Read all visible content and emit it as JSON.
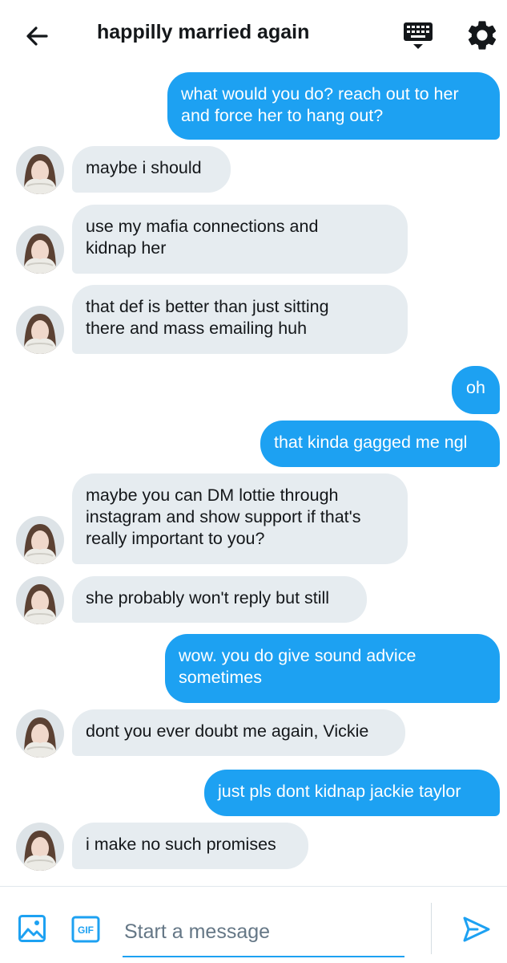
{
  "header": {
    "title": "happilly married again",
    "back_icon": "arrow-left-icon",
    "keyboard_icon": "keyboard-icon",
    "settings_icon": "gear-icon"
  },
  "colors": {
    "accent": "#1da1f2",
    "incoming_bubble": "#e6ecf0",
    "text": "#14171a",
    "placeholder": "#657786"
  },
  "messages": [
    {
      "from": "me",
      "text": "what would you do? reach out to her\nand force her to hang out?"
    },
    {
      "from": "them",
      "text": "maybe i should"
    },
    {
      "from": "them",
      "text": "use my mafia connections and\nkidnap her"
    },
    {
      "from": "them",
      "text": "that def is better than just sitting\nthere and mass emailing huh"
    },
    {
      "from": "me",
      "text": "oh"
    },
    {
      "from": "me",
      "text": "that kinda gagged me ngl"
    },
    {
      "from": "them",
      "text": "maybe you can DM lottie through\ninstagram and show support if that's\nreally important to you?"
    },
    {
      "from": "them",
      "text": "she probably won't reply but still"
    },
    {
      "from": "me",
      "text": "wow. you do give sound advice\nsometimes"
    },
    {
      "from": "them",
      "text": "dont you ever doubt me again, Vickie"
    },
    {
      "from": "me",
      "text": "just pls dont kidnap jackie taylor"
    },
    {
      "from": "them",
      "text": "i make no such promises"
    }
  ],
  "composer": {
    "placeholder": "Start a message",
    "value": "",
    "media_icon": "image-icon",
    "gif_label": "GIF",
    "send_icon": "send-icon"
  }
}
